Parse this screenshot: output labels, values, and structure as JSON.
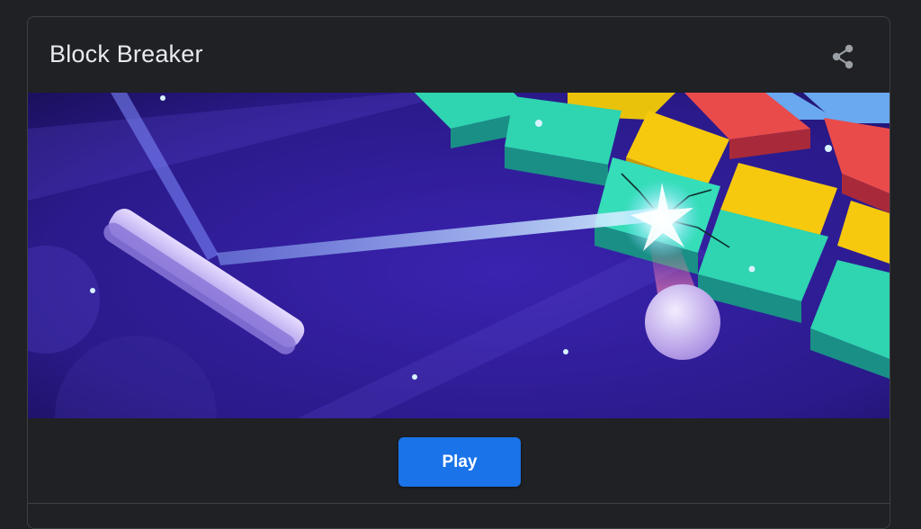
{
  "card": {
    "title": "Block Breaker",
    "share_icon": "share-icon"
  },
  "hero": {
    "image_alt": "game-artwork",
    "colors": {
      "background": "#2a1a8a",
      "teal": "#2fd4b0",
      "yellow": "#f6c90e",
      "red": "#e94b4b",
      "blue": "#6aa8f0",
      "ball": "#c9b3f0"
    }
  },
  "footer": {
    "play_label": "Play",
    "play_color": "#1a73e8"
  }
}
